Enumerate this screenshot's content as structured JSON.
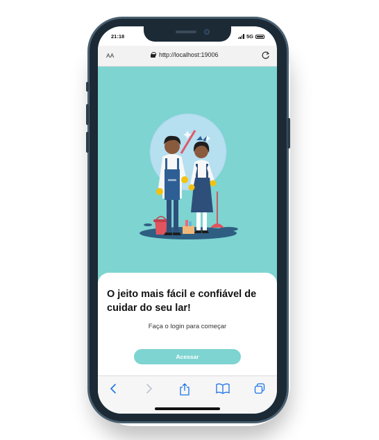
{
  "status_bar": {
    "time": "21:18",
    "network": "5G"
  },
  "browser": {
    "text_size_label": "AA",
    "url": "http://localhost:19006",
    "icons": [
      "lock-icon",
      "reload-icon"
    ]
  },
  "main": {
    "illustration": "cleaning-couple-illustration",
    "headline": "O jeito mais fácil e confiável de cuidar do seu lar!",
    "subtitle": "Faça o login para começar",
    "access_button_label": "Acessar"
  },
  "toolbar": {
    "icons": [
      "back-icon",
      "forward-icon",
      "share-icon",
      "bookmarks-icon",
      "tabs-icon"
    ]
  },
  "colors": {
    "accent": "#7dd4d1",
    "frame": "#1c2a36",
    "ios_blue": "#1a73e8"
  }
}
